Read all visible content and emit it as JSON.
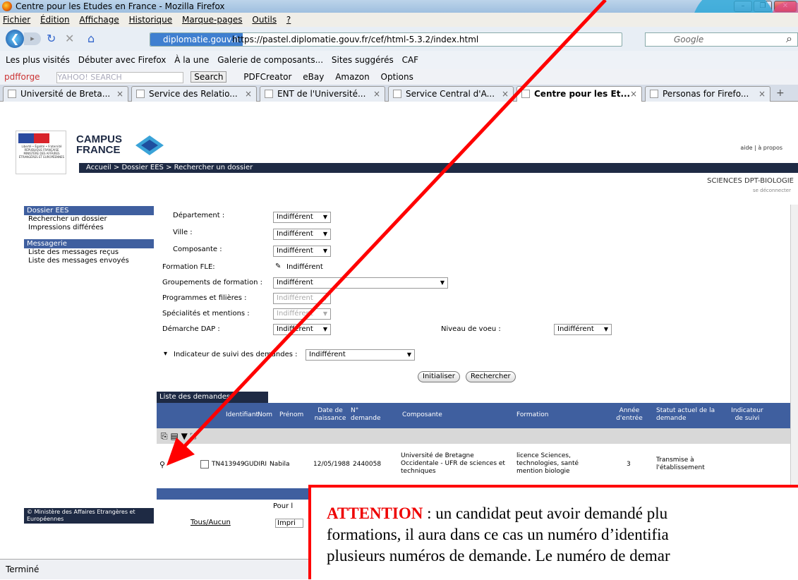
{
  "window": {
    "title": "Centre pour les Etudes en France - Mozilla Firefox"
  },
  "menu": {
    "items": [
      "Fichier",
      "Édition",
      "Affichage",
      "Historique",
      "Marque-pages",
      "Outils",
      "?"
    ]
  },
  "nav": {
    "url_site": "diplomatie.gouv.fr",
    "url": "https://pastel.diplomatie.gouv.fr/cef/html-5.3.2/index.html",
    "search_placeholder": "Google"
  },
  "bookmarks": [
    "Les plus visités",
    "Débuter avec Firefox",
    "À la une",
    "Galerie de composants...",
    "Sites suggérés",
    "CAF"
  ],
  "yahoo_toolbar": {
    "brand": "pdfforge",
    "search_placeholder": "YAHOO! SEARCH",
    "search_button": "Search",
    "items": [
      "PDFCreator",
      "eBay",
      "Amazon",
      "Options"
    ]
  },
  "tabs": [
    {
      "label": "Université de Breta..."
    },
    {
      "label": "Service des Relatio..."
    },
    {
      "label": "ENT de l'Université..."
    },
    {
      "label": "Service Central d'A..."
    },
    {
      "label": "Centre pour les Et..."
    },
    {
      "label": "Personas for Firefo..."
    }
  ],
  "site": {
    "logo_line1": "CAMPUS",
    "logo_line2": "FRANCE",
    "flag_text": "Liberté • Égalité • Fraternité RÉPUBLIQUE FRANÇAISE MINISTÈRE DES AFFAIRES ÉTRANGÈRES ET EUROPÉENNES",
    "breadcrumb": "Accueil > Dossier EES > Rechercher un dossier",
    "top_links": "aide | à propos",
    "department": "SCIENCES DPT-BIOLOGIE",
    "logout": "se déconnecter"
  },
  "sidebar": {
    "section1": "Dossier EES",
    "items1": [
      "Rechercher un dossier",
      "Impressions différées"
    ],
    "section2": "Messagerie",
    "items2": [
      "Liste des messages reçus",
      "Liste des messages envoyés"
    ],
    "footer": "© Ministère des Affaires Etrangères et Européennes"
  },
  "form": {
    "departement_label": "Département :",
    "ville_label": "Ville :",
    "composante_label": "Composante :",
    "fle_label": "Formation FLE:",
    "groupements_label": "Groupements de formation :",
    "programmes_label": "Programmes et filières :",
    "specialites_label": "Spécialités et mentions :",
    "dap_label": "Démarche DAP :",
    "niveau_label": "Niveau de voeu :",
    "indicateur_label": "Indicateur de suivi des demandes :",
    "value": "Indifférent",
    "btn_init": "Initialiser",
    "btn_search": "Rechercher"
  },
  "list": {
    "title": "Liste des demandes",
    "columns": [
      "Identifiant",
      "Nom",
      "Prénom",
      "Date de naissance",
      "N° demande",
      "Composante",
      "Formation",
      "Année d'entrée",
      "Statut actuel de la demande",
      "Indicateur de suivi"
    ],
    "row": {
      "identifiant": "TN413949",
      "nom": "GUDIRI",
      "prenom": "Nabila",
      "date": "12/05/1988",
      "numero": "2440058",
      "composante": "Université de Bretagne Occidentale - UFR de sciences et techniques",
      "formation": "licence Sciences, technologies, santé mention biologie",
      "annee": "3",
      "statut": "Transmise à l'établissement"
    },
    "pour_label": "Pour l",
    "tous": "Tous/Aucun",
    "impri": "Impri"
  },
  "status": "Terminé",
  "annotation": {
    "keyword": "ATTENTION",
    "line1": " : un candidat peut avoir demandé plu",
    "line2": "formations, il aura dans ce cas un numéro d’identifia",
    "line3": "plusieurs numéros de demande. Le numéro de demar",
    "colors": {
      "arrow": "#ff0000",
      "keyword": "#e00000"
    }
  }
}
